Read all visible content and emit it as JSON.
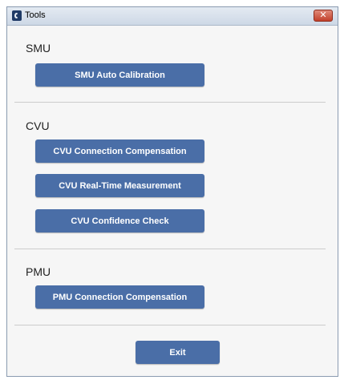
{
  "window": {
    "title": "Tools",
    "close_glyph": "✕"
  },
  "smu": {
    "label": "SMU",
    "buttons": [
      "SMU Auto Calibration"
    ]
  },
  "cvu": {
    "label": "CVU",
    "buttons": [
      "CVU Connection Compensation",
      "CVU Real-Time Measurement",
      "CVU Confidence Check"
    ]
  },
  "pmu": {
    "label": "PMU",
    "buttons": [
      "PMU Connection Compensation"
    ]
  },
  "footer": {
    "exit_label": "Exit"
  },
  "colors": {
    "button": "#4a6ea7",
    "button_text": "#ffffff",
    "close_button": "#c2402a"
  },
  "icons": {
    "app": "app-logo-icon",
    "close": "close-icon"
  }
}
